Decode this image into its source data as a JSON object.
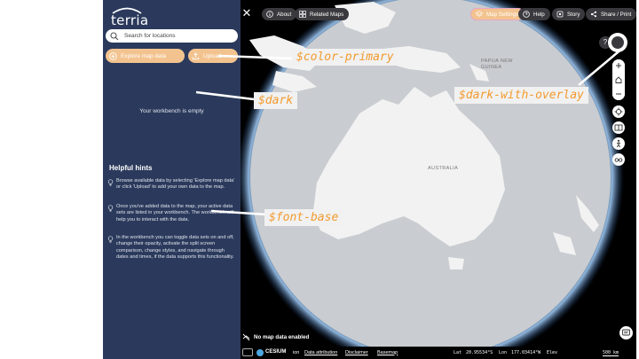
{
  "sidebar": {
    "logo_text": "terria",
    "search": {
      "placeholder": "Search for locations",
      "value": ""
    },
    "explore_label": "Explore map data",
    "upload_label": "Upload",
    "workbench_empty": "Your workbench is empty",
    "hints": {
      "title": "Helpful hints",
      "items": [
        "Browse available data by selecting 'Explore map data' or click 'Upload' to add your own data to the map.",
        "Once you've added data to the map, your active data sets are listed in your workbench. The workbench will help you to interact with the data.",
        "In the workbench you can toggle data sets on and off, change their opacity, activate the split screen comparison, change styles, and navigate through dates and times, if the data supports this functionality."
      ]
    }
  },
  "map": {
    "top": {
      "about": "About",
      "related_maps": "Related Maps",
      "map_settings": "Map Settings",
      "help": "Help",
      "story": "Story",
      "share": "Share / Print"
    },
    "help_glyph": "?",
    "places": {
      "papua": "PAPUA NEW\nGUINEA",
      "australia": "AUSTRALIA"
    },
    "no_map_data": "No map data enabled",
    "bottom": {
      "cesium": "CESIUM",
      "ion": "ion",
      "data_attribution": "Data attribution",
      "disclaimer": "Disclaimer",
      "basemap": "Basemap",
      "lat_label": "Lat",
      "lat_value": "20.95534°S",
      "lon_label": "Lon",
      "lon_value": "177.03414°W",
      "elev_label": "Elev",
      "scale": "500 km"
    }
  },
  "annotations": {
    "color_primary": "$color-primary",
    "dark": "$dark",
    "dark_with_overlay": "$dark-with-overlay",
    "font_base": "$font-base"
  },
  "colors": {
    "sidebar_bg": "#2b3a5c",
    "primary": "#f3c38f",
    "annotation_text": "#f29a2e",
    "map_button_bg": "#3a3a3e",
    "map_settings_highlight": "#e7a8c6"
  }
}
